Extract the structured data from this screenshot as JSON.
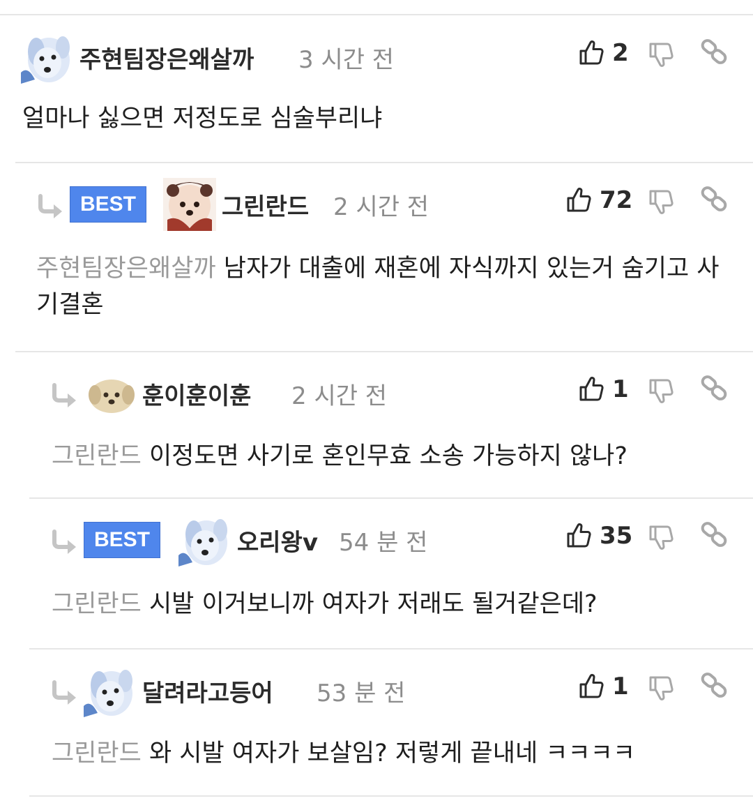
{
  "comments": [
    {
      "nickname": "주현팀장은왜살까",
      "time": "3 시간 전",
      "likes": "2",
      "text": "얼마나 싫으면 저정도로 심술부리냐"
    },
    {
      "badge": "BEST",
      "nickname": "그린란드",
      "time": "2 시간 전",
      "likes": "72",
      "mention": "주현팀장은왜살까",
      "text": "남자가 대출에 재혼에 자식까지 있는거 숨기고 사기결혼"
    },
    {
      "nickname": "훈이훈이훈",
      "time": "2 시간 전",
      "likes": "1",
      "mention": "그린란드",
      "text": "이정도면 사기로 혼인무효 소송 가능하지 않나?"
    },
    {
      "badge": "BEST",
      "nickname": "오리왕v",
      "time": "54 분 전",
      "likes": "35",
      "mention": "그린란드",
      "text": "시발 이거보니까 여자가 저래도 될거같은데?"
    },
    {
      "nickname": "달려라고등어",
      "time": "53 분 전",
      "likes": "1",
      "mention": "그린란드",
      "text": "와 시발 여자가 보살임? 저렇게 끝내네 ㅋㅋㅋㅋ"
    }
  ],
  "icons": {
    "like": "thumbs-up-icon",
    "dislike": "thumbs-down-icon",
    "link": "link-icon",
    "reply": "reply-arrow-icon"
  },
  "colors": {
    "badge": "#4f86ec",
    "mention": "#9a9a9a",
    "time": "#8c8c8c",
    "divider": "#e6e6e6"
  }
}
